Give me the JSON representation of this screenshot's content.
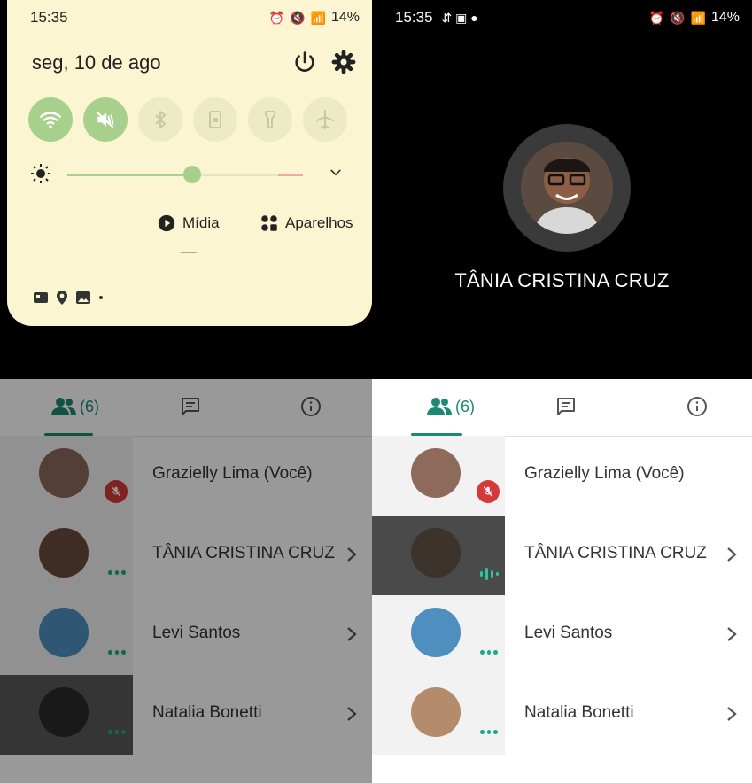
{
  "left": {
    "status_time": "15:35",
    "battery": "14%",
    "qs": {
      "date": "seg, 10 de ago",
      "brightness_level": 0.53,
      "media_label": "Mídia",
      "devices_label": "Aparelhos",
      "toggles": [
        "wifi-icon",
        "mute-icon",
        "bluetooth-icon",
        "rotation-lock-icon",
        "flashlight-icon",
        "airplane-icon"
      ]
    }
  },
  "right": {
    "status_time": "15:35",
    "battery": "14%",
    "caller_name": "TÂNIA CRISTINA CRUZ"
  },
  "tabs": {
    "people_count": "(6)"
  },
  "participants": [
    {
      "name": "Grazielly Lima (Você)",
      "status": "muted",
      "avatar_color": "#8d6a5a"
    },
    {
      "name": "TÂNIA CRISTINA CRUZ",
      "status": "speaking",
      "avatar_color": "#6b4e3f"
    },
    {
      "name": "Levi Santos",
      "status": "dots",
      "avatar_color": "#4f8fbf"
    },
    {
      "name": "Natalia Bonetti",
      "status": "dots",
      "avatar_color": "#b48b6b"
    }
  ],
  "colors": {
    "accent": "#1b8a74",
    "qs_background": "#fbf5d1",
    "toggle_on": "#a8d08d",
    "mute_red": "#d43a3a"
  }
}
